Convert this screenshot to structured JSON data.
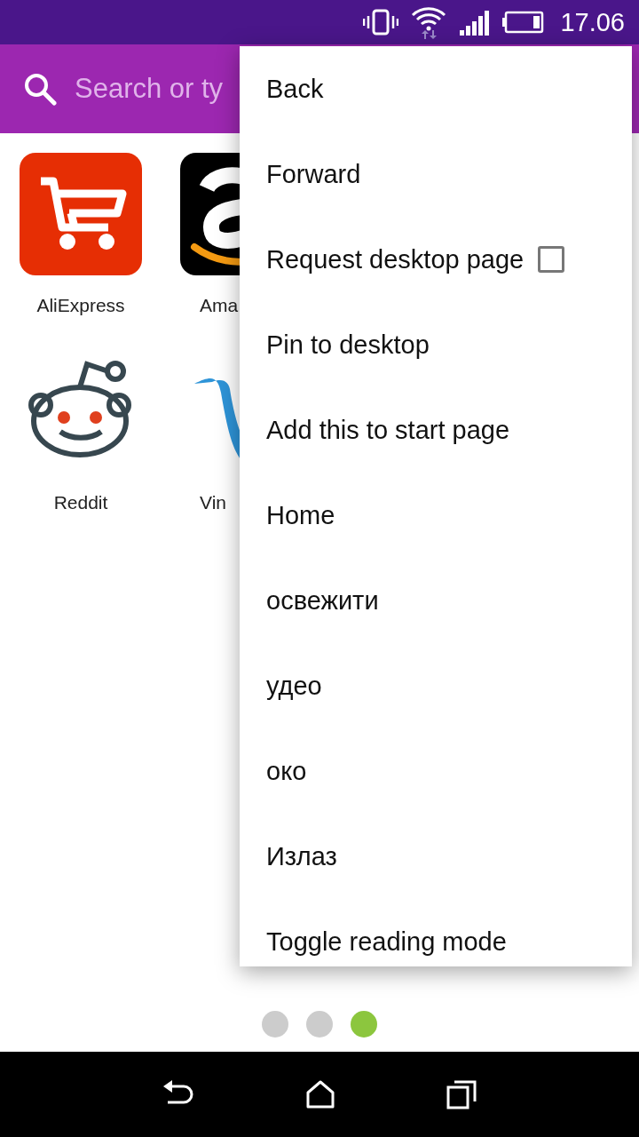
{
  "status_bar": {
    "time": "17.06"
  },
  "search": {
    "placeholder": "Search or ty"
  },
  "shortcuts": [
    {
      "label": "AliExpress",
      "kind": "cart"
    },
    {
      "label": "Ama",
      "kind": "smile"
    },
    {
      "label": "Reddit",
      "kind": "alien"
    },
    {
      "label": "Vin",
      "kind": "swoosh"
    }
  ],
  "menu": [
    {
      "label": "Back",
      "kind": "action"
    },
    {
      "label": "Forward",
      "kind": "action"
    },
    {
      "label": "Request desktop page",
      "kind": "checkbox",
      "checked": false
    },
    {
      "label": "Pin to desktop",
      "kind": "action"
    },
    {
      "label": "Add this to start page",
      "kind": "action"
    },
    {
      "label": "Home",
      "kind": "action"
    },
    {
      "label": "освежити",
      "kind": "action"
    },
    {
      "label": "удео",
      "kind": "action"
    },
    {
      "label": "око",
      "kind": "action"
    },
    {
      "label": "Излаз",
      "kind": "action"
    },
    {
      "label": "Toggle reading mode",
      "kind": "action"
    }
  ],
  "page_dots": [
    {
      "selected": false
    },
    {
      "selected": false
    },
    {
      "selected": true
    }
  ]
}
